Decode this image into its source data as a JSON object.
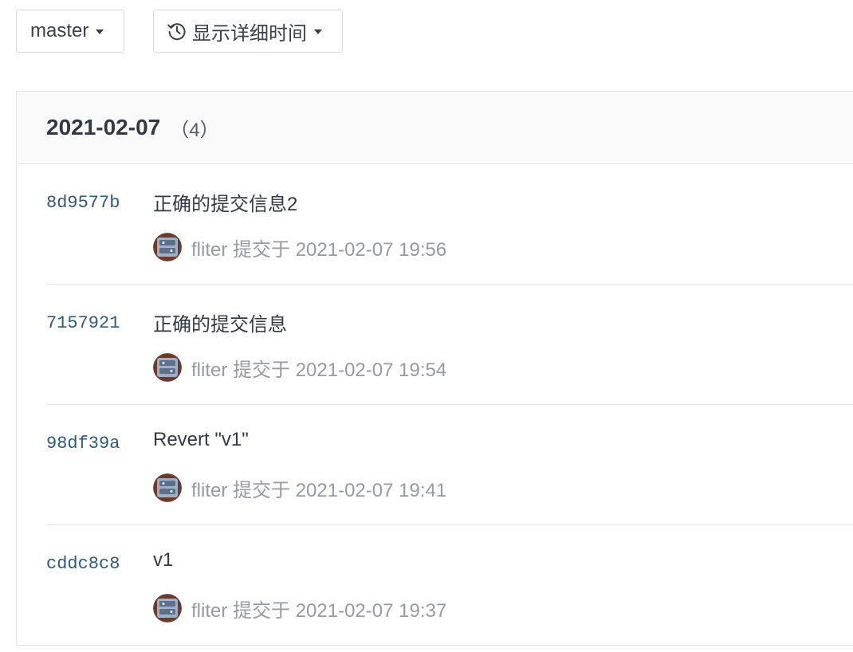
{
  "toolbar": {
    "branch_label": "master",
    "time_toggle_label": "显示详细时间",
    "time_toggle_icon": "history-icon"
  },
  "group": {
    "date": "2021-02-07",
    "count": "（4）"
  },
  "commits": [
    {
      "sha": "8d9577b",
      "title": "正确的提交信息2",
      "author": "fliter",
      "action": "提交于",
      "time": "2021-02-07 19:56"
    },
    {
      "sha": "7157921",
      "title": "正确的提交信息",
      "author": "fliter",
      "action": "提交于",
      "time": "2021-02-07 19:54"
    },
    {
      "sha": "98df39a",
      "title": "Revert \"v1\"",
      "author": "fliter",
      "action": "提交于",
      "time": "2021-02-07 19:41"
    },
    {
      "sha": "cddc8c8",
      "title": "v1",
      "author": "fliter",
      "action": "提交于",
      "time": "2021-02-07 19:37"
    }
  ],
  "colors": {
    "sha": "#2e5a7c",
    "meta": "#979aa2",
    "border": "#e3e5e9"
  }
}
